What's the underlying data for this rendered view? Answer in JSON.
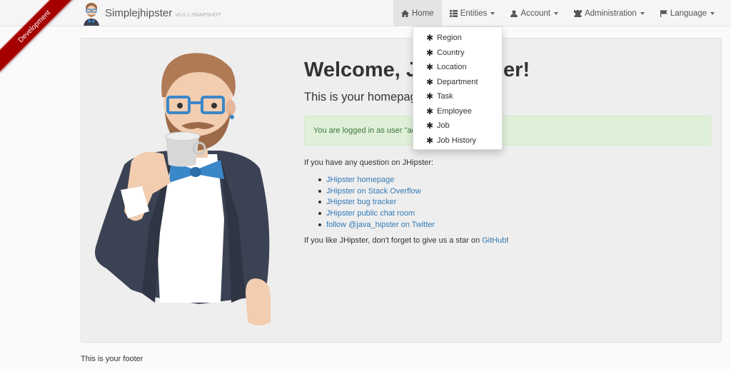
{
  "ribbon": {
    "label": "Development"
  },
  "brand": {
    "name": "Simplejhipster",
    "version": "v0.0.1-SNAPSHOT"
  },
  "nav": {
    "home": "Home",
    "entities": "Entities",
    "account": "Account",
    "administration": "Administration",
    "language": "Language"
  },
  "entities_menu": {
    "items": [
      "Region",
      "Country",
      "Location",
      "Department",
      "Task",
      "Employee",
      "Job",
      "Job History"
    ]
  },
  "main": {
    "title": "Welcome, J",
    "title_tail": "er!",
    "subtitle": "This is your homepage",
    "alert": "You are logged in as user \"ad",
    "question": "If you have any question on JHipster:",
    "links": [
      "JHipster homepage",
      "JHipster on Stack Overflow",
      "JHipster bug tracker",
      "JHipster public chat room",
      "follow @java_hipster on Twitter"
    ],
    "star_prefix": "If you like JHipster, don't forget to give us a star on ",
    "star_link": "GitHub",
    "star_suffix": "!"
  },
  "footer": {
    "text": "This is your footer"
  },
  "colors": {
    "ribbon": "#a50000",
    "link": "#337ab7",
    "alert_bg": "#dff0d8",
    "alert_text": "#3c763d"
  }
}
